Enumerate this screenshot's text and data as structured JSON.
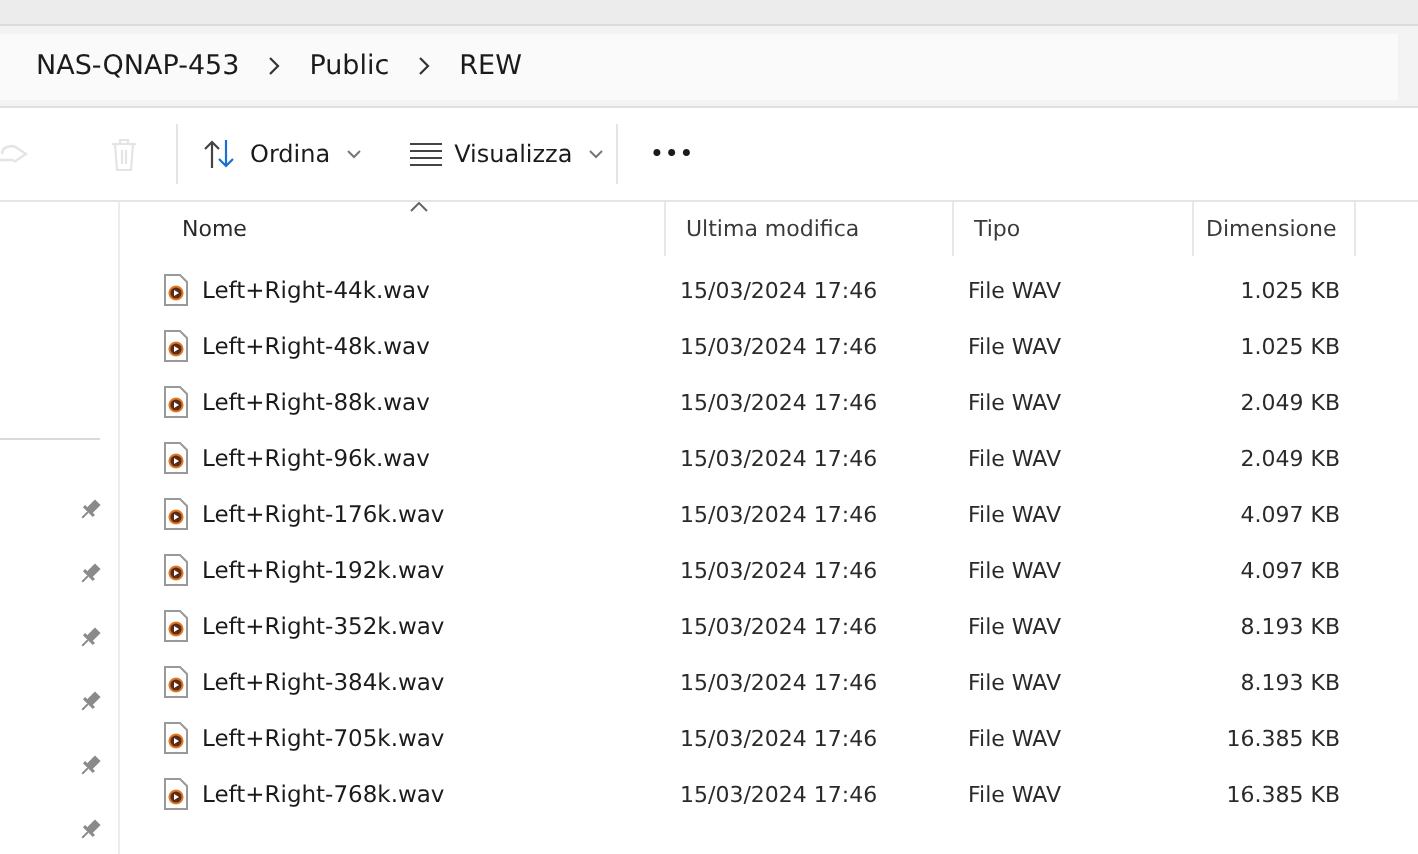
{
  "breadcrumb": [
    {
      "label": "NAS-QNAP-453"
    },
    {
      "label": "Public"
    },
    {
      "label": "REW"
    }
  ],
  "toolbar": [
    {
      "kind": "share",
      "disabled": true
    },
    {
      "kind": "delete",
      "disabled": true
    },
    {
      "kind": "sort",
      "label": "Ordina",
      "disabled": false
    },
    {
      "kind": "view",
      "label": "Visualizza",
      "disabled": false
    },
    {
      "kind": "more",
      "label": "•••",
      "disabled": false
    }
  ],
  "sidebar": {
    "items": [
      {
        "pinned": true
      },
      {
        "pinned": true
      },
      {
        "pinned": true
      },
      {
        "pinned": true
      },
      {
        "pinned": true
      },
      {
        "pinned": true
      }
    ]
  },
  "table": {
    "columns": [
      {
        "label": "Nome",
        "sorted": true
      },
      {
        "label": "Ultima modifica",
        "sorted": false
      },
      {
        "label": "Tipo",
        "sorted": false
      },
      {
        "label": "Dimensione",
        "sorted": false
      }
    ],
    "rows": [
      {
        "cells": [
          "Left+Right-44k.wav",
          "15/03/2024 17:46",
          "File WAV",
          "1.025 KB"
        ]
      },
      {
        "cells": [
          "Left+Right-48k.wav",
          "15/03/2024 17:46",
          "File WAV",
          "1.025 KB"
        ]
      },
      {
        "cells": [
          "Left+Right-88k.wav",
          "15/03/2024 17:46",
          "File WAV",
          "2.049 KB"
        ]
      },
      {
        "cells": [
          "Left+Right-96k.wav",
          "15/03/2024 17:46",
          "File WAV",
          "2.049 KB"
        ]
      },
      {
        "cells": [
          "Left+Right-176k.wav",
          "15/03/2024 17:46",
          "File WAV",
          "4.097 KB"
        ]
      },
      {
        "cells": [
          "Left+Right-192k.wav",
          "15/03/2024 17:46",
          "File WAV",
          "4.097 KB"
        ]
      },
      {
        "cells": [
          "Left+Right-352k.wav",
          "15/03/2024 17:46",
          "File WAV",
          "8.193 KB"
        ]
      },
      {
        "cells": [
          "Left+Right-384k.wav",
          "15/03/2024 17:46",
          "File WAV",
          "8.193 KB"
        ]
      },
      {
        "cells": [
          "Left+Right-705k.wav",
          "15/03/2024 17:46",
          "File WAV",
          "16.385 KB"
        ]
      },
      {
        "cells": [
          "Left+Right-768k.wav",
          "15/03/2024 17:46",
          "File WAV",
          "16.385 KB"
        ]
      }
    ]
  }
}
